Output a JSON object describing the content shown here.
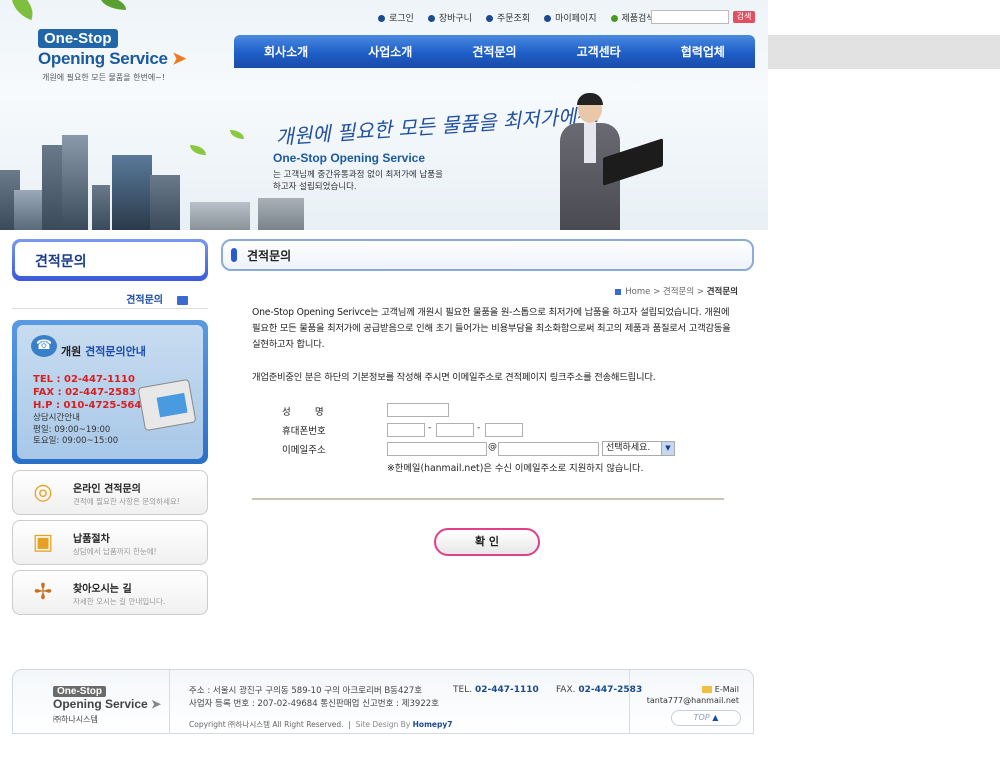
{
  "header": {
    "logo_top": "One-Stop",
    "logo_main": "Opening Service",
    "logo_sub": "개원에 필요한 모든 물품을 한번에~!",
    "top_links": [
      "로그인",
      "장바구니",
      "주문조회",
      "마이페이지",
      "제품검색"
    ],
    "search_button": "검색",
    "gnb": [
      "회사소개",
      "사업소개",
      "견적문의",
      "고객센타",
      "협력업체"
    ],
    "visual_slogan": "개원에 필요한 모든 물품을 최저가에~!",
    "visual_brand": "One-Stop Opening Service",
    "visual_desc_1": "는 고객님께 중간유통과정 없이 최저가에 납품을",
    "visual_desc_2": "하고자 설립되었습니다."
  },
  "sidebar": {
    "title": "견적문의",
    "active_item": "견적문의",
    "info_title_a": "개원",
    "info_title_b": "견적문의안내",
    "tel": "TEL : 02-447-1110",
    "fax": "FAX : 02-447-2583",
    "hp": "H.P : 010-4725-5643",
    "hours_title": "상담시간안내",
    "hours_weekday": "평일: 09:00~19:00",
    "hours_saturday": "토요일: 09:00~15:00",
    "buttons": [
      {
        "title": "온라인 견적문의",
        "sub": "견적에 필요한 사항은 문의하세요!"
      },
      {
        "title": "납품절차",
        "sub": "상담에서 납품까지 한눈에!"
      },
      {
        "title": "찾아오시는 길",
        "sub": "자세한 오시는 길 안내입니다."
      }
    ]
  },
  "content": {
    "title": "견적문의",
    "breadcrumb_home": "Home",
    "breadcrumb_mid": "견적문의",
    "breadcrumb_current": "견적문의",
    "intro": "One-Stop Opening Serivce는 고객님께 개원시 필요한 물품을 원-스톱으로 최저가에 납품을 하고자 설립되었습니다. 개원에 필요한 모든 물품을 최저가에 공급받음으로 인해 초기 들어가는 비용부담을 최소화함으로써 최고의 제품과 품질로서 고객감동을 실현하고자 합니다.",
    "notice": "개업준비중인 분은 하단의 기본정보를 작성해 주시면 이메일주소로 견적페이지 링크주소를 전송해드립니다.",
    "form": {
      "name_label": "성        명",
      "phone_label": "휴대폰번호",
      "email_label": "이메일주소",
      "name_value": "",
      "phone1_value": "",
      "phone2_value": "",
      "phone3_value": "",
      "email_id_value": "",
      "email_domain_value": "",
      "at": "@",
      "dash": "-",
      "domain_select": "선택하세요.",
      "email_note": "※한메일(hanmail.net)은 수신 이메일주소로 지원하지 않습니다."
    },
    "confirm_button": "확 인"
  },
  "footer": {
    "logo_top": "One-Stop",
    "logo_main": "Opening Service",
    "company": "㈜하나시스템",
    "address_1": "주소 : 서울시 광진구 구의동 589-10 구의 아크로리버 B동427호",
    "address_2": "사업자 등록 번호 : 207-02-49684   통신판매업 신고번호 : 제3922호",
    "tel_label": "TEL.",
    "tel": "02-447-1110",
    "fax_label": "FAX.",
    "fax": "02-447-2583",
    "copyright": "Copyright ㈜하나시스템 All Right Reserved.",
    "design_label": "Site Design By",
    "design_by": "Homepy7",
    "email_label": "E-Mail",
    "email": "tanta777@hanmail.net",
    "top_button": "TOP"
  },
  "colors": {
    "gnb_blue": "#1e5ec8",
    "accent_pink": "#e0408a",
    "tel_red": "#d82020"
  }
}
